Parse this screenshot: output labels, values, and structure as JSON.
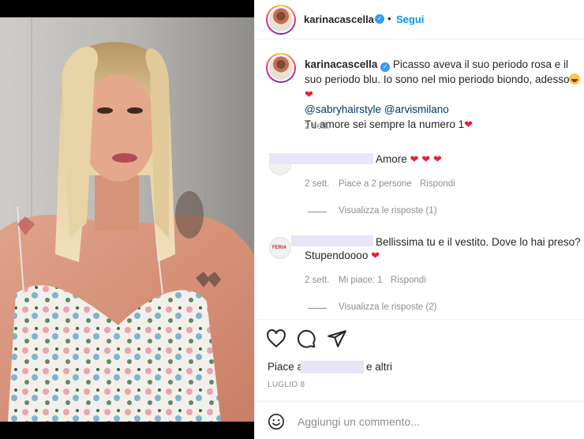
{
  "post": {
    "username": "karinacascella",
    "follow_label": "Segui",
    "separator": "•"
  },
  "caption": {
    "username": "karinacascella",
    "text_1": "Picasso aveva il suo periodo rosa e il suo periodo blu. Io sono nel mio periodo biondo, adesso",
    "mention_1": "@sabryhairstyle",
    "mention_2": "@arvismilano",
    "line_2": "Tu amore sei sempre la numero 1",
    "time": "2 sett."
  },
  "comments": [
    {
      "text": "Amore",
      "time": "2 sett.",
      "likes": "Piace a 2 persone",
      "reply": "Rispondi",
      "view_replies": "Visualizza le risposte (1)"
    },
    {
      "text_1": "Bellissima tu e il vestito. Dove lo hai preso?",
      "text_2": "Stupendoooo",
      "time": "2 sett.",
      "likes": "Mi piace: 1",
      "reply": "Rispondi",
      "view_replies": "Visualizza le risposte (2)",
      "avatar_label": "FERIA"
    }
  ],
  "actions": {
    "likes_prefix": "Piace a",
    "likes_suffix": "e altri",
    "date": "LUGLIO 8",
    "comment_placeholder": "Aggiungi un commento..."
  },
  "icons": {
    "like": "heart-icon",
    "comment": "comment-icon",
    "share": "paper-plane-icon",
    "emoji": "emoji-icon"
  },
  "colors": {
    "link": "#0095f6",
    "mention": "#00376b",
    "verified": "#3897f0",
    "heart": "#ed1d38",
    "meta": "#8e8e8e"
  }
}
